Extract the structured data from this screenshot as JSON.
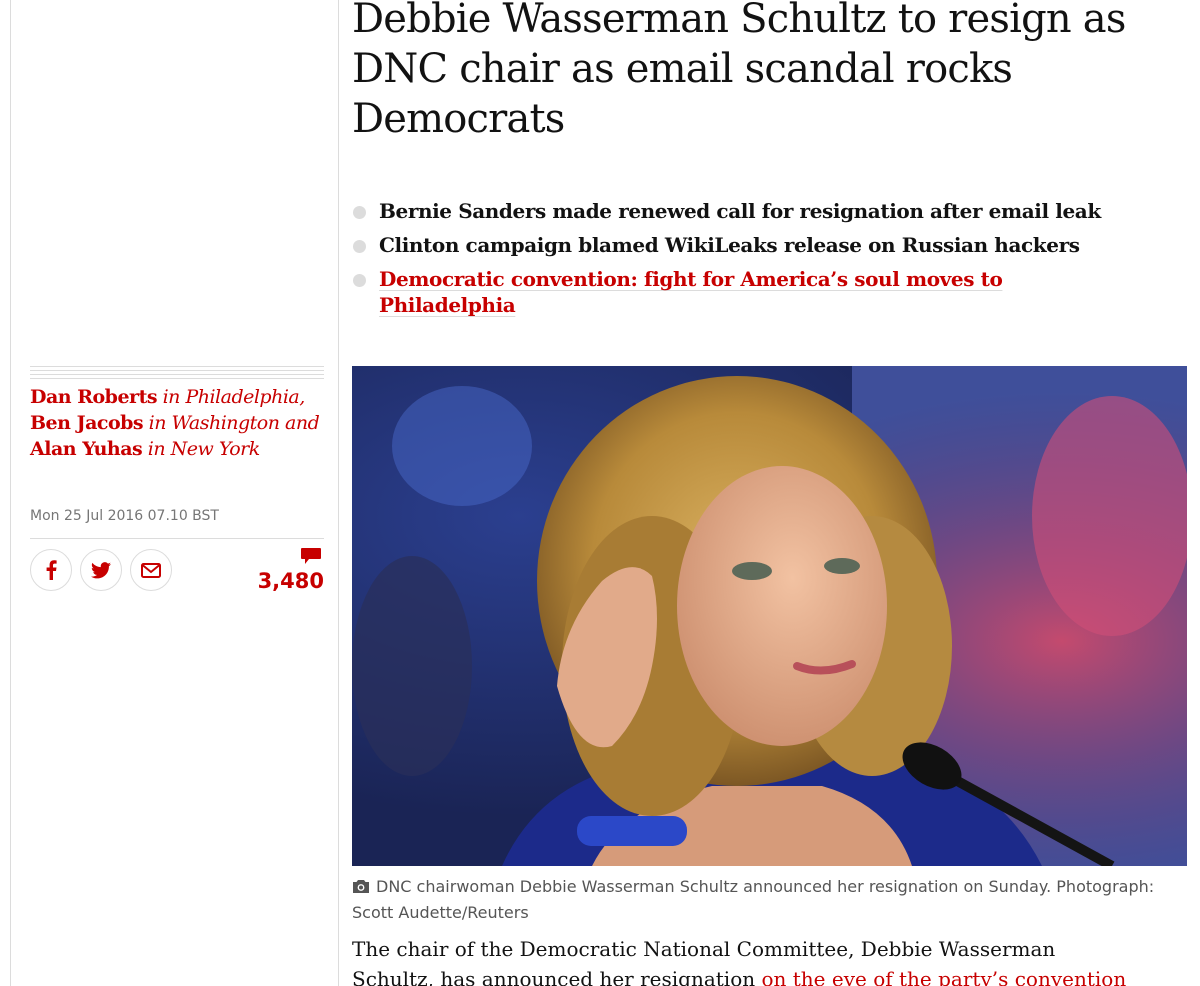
{
  "article": {
    "headline": "Debbie Wasserman Schultz to resign as DNC chair as email scandal rocks Democrats",
    "standfirst": [
      {
        "text": "Bernie Sanders made renewed call for resignation after email leak",
        "is_link": false
      },
      {
        "text": "Clinton campaign blamed WikiLeaks release on Russian hackers",
        "is_link": false
      },
      {
        "text": "Democratic convention: fight for America’s soul moves to Philadelphia",
        "is_link": true
      }
    ],
    "byline": {
      "author1": "Dan Roberts",
      "loc1": " in Philadelphia, ",
      "author2": "Ben Jacobs",
      "loc2": " in Washington and ",
      "author3": "Alan Yuhas",
      "loc3": " in New York"
    },
    "dateline": "Mon 25 Jul 2016 07.10 BST",
    "share": {
      "facebook_icon": "facebook-icon",
      "twitter_icon": "twitter-icon",
      "email_icon": "email-icon"
    },
    "comment_count": "3,480",
    "image": {
      "caption": "DNC chairwoman Debbie Wasserman Schultz announced her resignation on Sunday. Photograph: Scott Audette/Reuters"
    },
    "body": {
      "line1": "The chair of the Democratic National Committee, Debbie Wasserman",
      "line2_text": "Schultz, has announced her resignation ",
      "line2_link": "on the eve of the party’s convention"
    }
  },
  "colors": {
    "accent": "#c70000",
    "rule": "#dcdcdc",
    "text": "#121212",
    "muted": "#767676"
  }
}
